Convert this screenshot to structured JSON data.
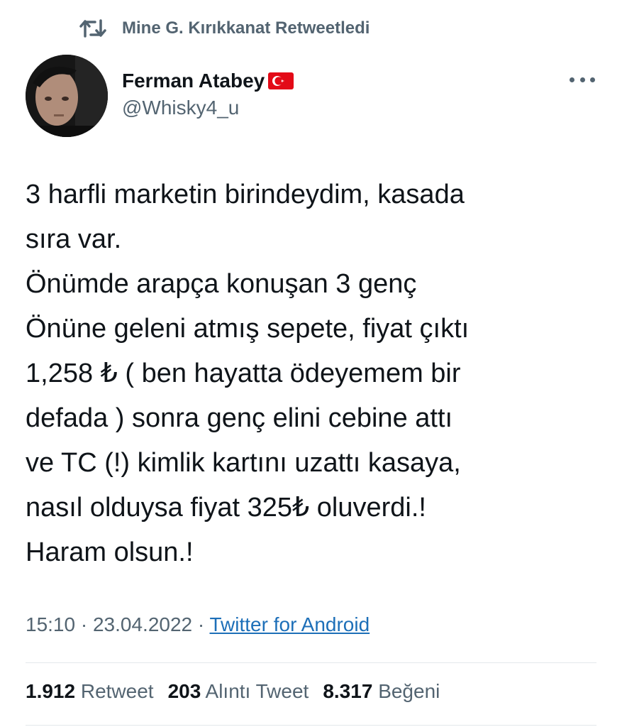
{
  "retweet_label": "Mine G. Kırıkkanat Retweetledi",
  "author": {
    "name": "Ferman Atabey",
    "handle": "@Whisky4_u",
    "flag": "turkey-flag-icon"
  },
  "tweet_text": "3 harfli marketin birindeydim, kasada\nsıra var.\nÖnümde arapça konuşan 3 genç\nÖnüne geleni atmış sepete, fiyat çıktı\n1,258 ₺ ( ben hayatta ödeyemem bir\ndefada ) sonra genç elini cebine attı\nve TC (!) kimlik kartını uzattı kasaya,\nnasıl olduysa fiyat 325₺ oluverdi.!\nHaram olsun.!",
  "meta": {
    "time": "15:10",
    "date": "23.04.2022",
    "separator": "·",
    "source": "Twitter for Android"
  },
  "stats": {
    "retweets": {
      "count": "1.912",
      "label": "Retweet"
    },
    "quotes": {
      "count": "203",
      "label": "Alıntı Tweet"
    },
    "likes": {
      "count": "8.317",
      "label": "Beğeni"
    }
  },
  "colors": {
    "text": "#0f1419",
    "secondary": "#536471",
    "link": "#1d6fb8",
    "flag_red": "#e30a17"
  }
}
